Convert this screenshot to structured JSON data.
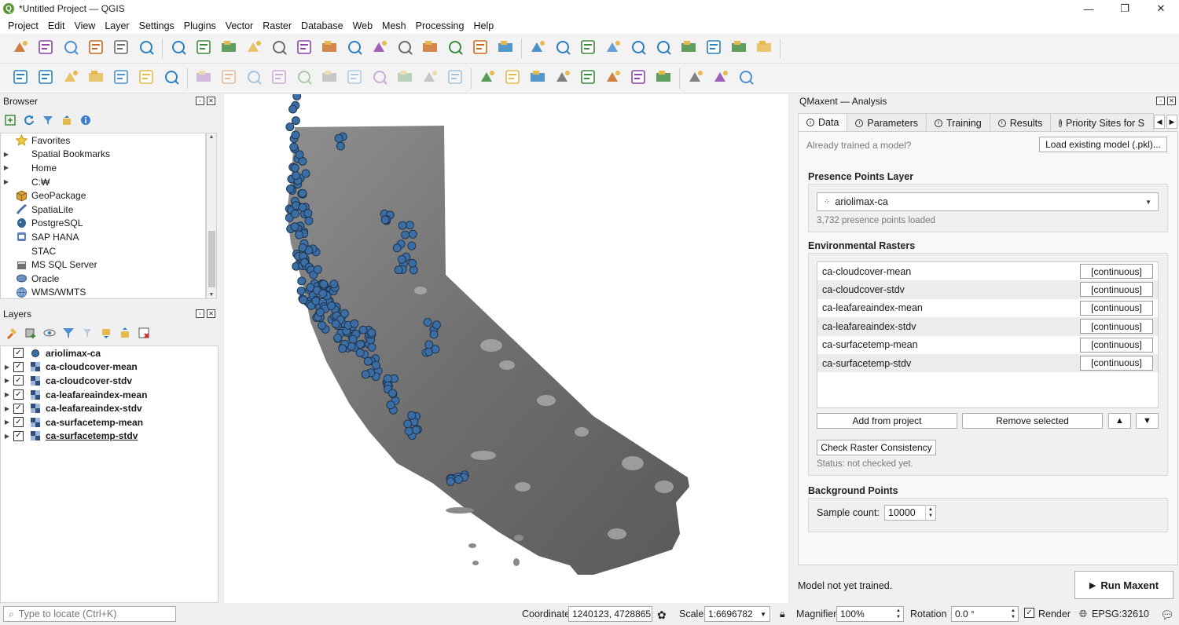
{
  "window": {
    "title": "*Untitled Project — QGIS",
    "logo_letter": "Q",
    "minimize": "—",
    "maximize": "❐",
    "close": "✕"
  },
  "menu": [
    "Project",
    "Edit",
    "View",
    "Layer",
    "Settings",
    "Plugins",
    "Vector",
    "Raster",
    "Database",
    "Web",
    "Mesh",
    "Processing",
    "Help"
  ],
  "browser": {
    "title": "Browser",
    "items": [
      {
        "label": "Favorites",
        "icon": "star-icon",
        "expand": ""
      },
      {
        "label": "Spatial Bookmarks",
        "icon": "bookmark-icon",
        "expand": "▶"
      },
      {
        "label": "Home",
        "icon": "folder-icon",
        "expand": "▶"
      },
      {
        "label": "C:₩",
        "icon": "folder-icon",
        "expand": "▶"
      },
      {
        "label": "GeoPackage",
        "icon": "geopackage-icon",
        "expand": ""
      },
      {
        "label": "SpatiaLite",
        "icon": "spatialite-icon",
        "expand": ""
      },
      {
        "label": "PostgreSQL",
        "icon": "postgresql-icon",
        "expand": ""
      },
      {
        "label": "SAP HANA",
        "icon": "sap-hana-icon",
        "expand": ""
      },
      {
        "label": "STAC",
        "icon": "stac-icon",
        "expand": ""
      },
      {
        "label": "MS SQL Server",
        "icon": "mssql-icon",
        "expand": ""
      },
      {
        "label": "Oracle",
        "icon": "oracle-icon",
        "expand": ""
      },
      {
        "label": "WMS/WMTS",
        "icon": "globe-icon",
        "expand": ""
      }
    ]
  },
  "layers": {
    "title": "Layers",
    "items": [
      {
        "label": "ariolimax-ca",
        "type": "point",
        "checked": "✓",
        "expand": ""
      },
      {
        "label": "ca-cloudcover-mean",
        "type": "raster",
        "checked": "✓",
        "expand": "▶"
      },
      {
        "label": "ca-cloudcover-stdv",
        "type": "raster",
        "checked": "✓",
        "expand": "▶"
      },
      {
        "label": "ca-leafareaindex-mean",
        "type": "raster",
        "checked": "✓",
        "expand": "▶"
      },
      {
        "label": "ca-leafareaindex-stdv",
        "type": "raster",
        "checked": "✓",
        "expand": "▶"
      },
      {
        "label": "ca-surfacetemp-mean",
        "type": "raster",
        "checked": "✓",
        "expand": "▶"
      },
      {
        "label": "ca-surfacetemp-stdv",
        "type": "raster",
        "checked": "✓",
        "expand": "▶"
      }
    ]
  },
  "qmaxent": {
    "title": "QMaxent — Analysis",
    "tabs": [
      {
        "label": "Data",
        "active": true
      },
      {
        "label": "Parameters",
        "active": false
      },
      {
        "label": "Training",
        "active": false
      },
      {
        "label": "Results",
        "active": false
      },
      {
        "label": "Priority Sites for S",
        "active": false
      }
    ],
    "already_trained": "Already trained a model?",
    "load_model": "Load existing model (.pkl)...",
    "presence": {
      "title": "Presence Points Layer",
      "layer": "ariolimax-ca",
      "status": "3,732 presence points loaded"
    },
    "rasters": {
      "title": "Environmental Rasters",
      "rows": [
        {
          "name": "ca-cloudcover-mean",
          "kind": "[continuous]"
        },
        {
          "name": "ca-cloudcover-stdv",
          "kind": "[continuous]"
        },
        {
          "name": "ca-leafareaindex-mean",
          "kind": "[continuous]"
        },
        {
          "name": "ca-leafareaindex-stdv",
          "kind": "[continuous]"
        },
        {
          "name": "ca-surfacetemp-mean",
          "kind": "[continuous]"
        },
        {
          "name": "ca-surfacetemp-stdv",
          "kind": "[continuous]"
        }
      ],
      "add": "Add from project",
      "remove": "Remove selected",
      "up": "▲",
      "down": "▼",
      "check": "Check Raster Consistency",
      "check_status": "Status: not checked yet."
    },
    "background": {
      "title": "Background Points",
      "label": "Sample count:",
      "value": "10000"
    },
    "model_status": "Model not yet trained.",
    "run": "Run Maxent"
  },
  "statusbar": {
    "locate_placeholder": "Type to locate (Ctrl+K)",
    "coordinate_label": "Coordinate",
    "coordinate": "1240123, 4728865",
    "scale_label": "Scale",
    "scale": "1:6696782",
    "magnifier_label": "Magnifier",
    "magnifier": "100%",
    "rotation_label": "Rotation",
    "rotation": "0.0 °",
    "render_label": "Render",
    "render_checked": "✓",
    "crs": "EPSG:32610"
  },
  "colors": {
    "point": "#3a6ea5",
    "point_stroke": "#1f3550",
    "raster_dark": "#5a5a5a",
    "raster_light": "#8f8f8f"
  },
  "toolbar_icons_row1": [
    "new-project-icon",
    "open-project-icon",
    "save-project-icon",
    "save-as-icon",
    "layout-icon",
    "style-manager-icon",
    "pan-icon",
    "pan-to-selection-icon",
    "zoom-in-icon",
    "zoom-out-icon",
    "zoom-full-icon",
    "zoom-selection-icon",
    "zoom-layer-icon",
    "zoom-native-icon",
    "zoom-last-icon",
    "zoom-next-icon",
    "new-bookmark-icon",
    "show-bookmarks-icon",
    "temporal-icon",
    "refresh-icon",
    "select-icon",
    "deselect-icon",
    "select-location-icon",
    "identify-icon",
    "attribute-table-icon",
    "processing-toolbox-icon",
    "statistics-icon",
    "measure-icon",
    "annotation-icon",
    "settings-icon"
  ],
  "toolbar_icons_row2": [
    "data-source-manager-icon",
    "new-geopackage-icon",
    "new-shapefile-icon",
    "new-spatialite-icon",
    "new-virtual-icon",
    "new-temp-scratch-icon",
    "add-raster-icon",
    "digitize-icon",
    "edit-icon",
    "save-edits-icon",
    "add-feature-icon",
    "vertex-tool-icon",
    "delete-icon",
    "cut-icon",
    "copy-icon",
    "paste-icon",
    "undo-icon",
    "redo-icon",
    "label-icon",
    "layer-labeling-icon",
    "pin-labels-icon",
    "highlight-labels-icon",
    "show-hide-labels-icon",
    "move-label-icon",
    "rotate-label-icon",
    "change-label-icon",
    "qmaxent-icon",
    "python-icon",
    "help-icon"
  ]
}
